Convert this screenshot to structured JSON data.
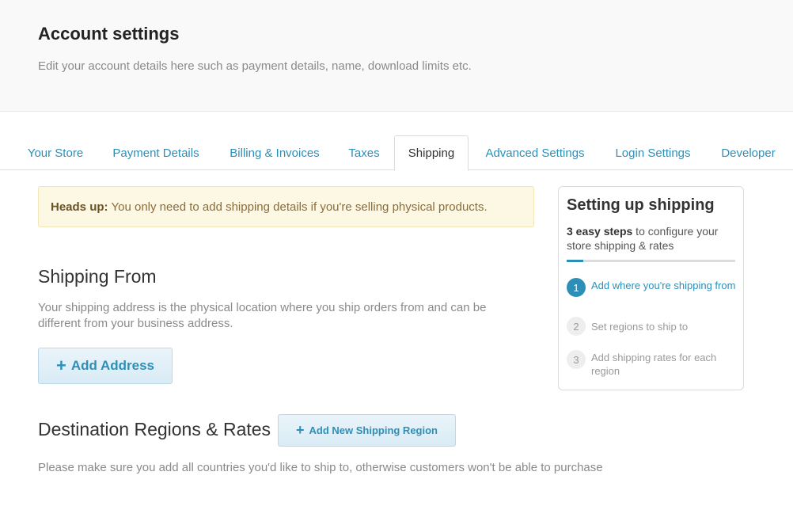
{
  "header": {
    "title": "Account settings",
    "subtitle": "Edit your account details here such as payment details, name, download limits etc."
  },
  "tabs": [
    {
      "label": "Your Store"
    },
    {
      "label": "Payment Details"
    },
    {
      "label": "Billing & Invoices"
    },
    {
      "label": "Taxes"
    },
    {
      "label": "Shipping",
      "active": true
    },
    {
      "label": "Advanced Settings"
    },
    {
      "label": "Login Settings"
    },
    {
      "label": "Developer"
    }
  ],
  "alert": {
    "strong": "Heads up:",
    "text": "You only need to add shipping details if you're selling physical products."
  },
  "shipping_from": {
    "title": "Shipping From",
    "description": "Your shipping address is the physical location where you ship orders from and can be different from your business address.",
    "button_icon": "+",
    "button_label": "Add Address"
  },
  "destination": {
    "title": "Destination Regions & Rates",
    "button_icon": "+",
    "button_label": "Add New Shipping Region",
    "description": "Please make sure you add all countries you'd like to ship to, otherwise customers won't be able to purchase"
  },
  "sidebar": {
    "title": "Setting up shipping",
    "intro_bold": "3 easy steps",
    "intro_rest": " to configure your store shipping & rates",
    "progress": 0.1,
    "steps": [
      {
        "num": "1",
        "label": "Add where you're shipping from",
        "active": true
      },
      {
        "num": "2",
        "label": "Set regions to ship to",
        "active": false
      },
      {
        "num": "3",
        "label": "Add shipping rates for each region",
        "active": false
      }
    ]
  },
  "colors": {
    "accent": "#2d8fb8",
    "alert_bg": "#fdf8e4"
  }
}
